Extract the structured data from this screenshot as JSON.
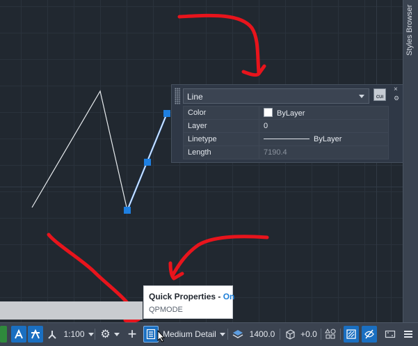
{
  "styles_browser": {
    "label": "Styles Browser"
  },
  "quick_properties": {
    "object_type": "Line",
    "cui_label": "CUI",
    "close_glyph": "×",
    "options_glyph": "⚙",
    "rows": [
      {
        "name": "Color",
        "value": "ByLayer"
      },
      {
        "name": "Layer",
        "value": "0"
      },
      {
        "name": "Linetype",
        "value": "ByLayer"
      },
      {
        "name": "Length",
        "value": "7190.4"
      }
    ]
  },
  "tooltip": {
    "title": "Quick Properties",
    "separator": " - ",
    "state": "On",
    "command": "QPMODE"
  },
  "status_bar": {
    "scale": "1:100",
    "detail_level": "Medium Detail",
    "elevation": "1400.0",
    "offset": "+0.0"
  },
  "colors": {
    "accent": "#1a6fc1",
    "grip": "#1e7fe0",
    "annotation_red": "#e8141c",
    "tooltip_state": "#1e7fd8"
  }
}
